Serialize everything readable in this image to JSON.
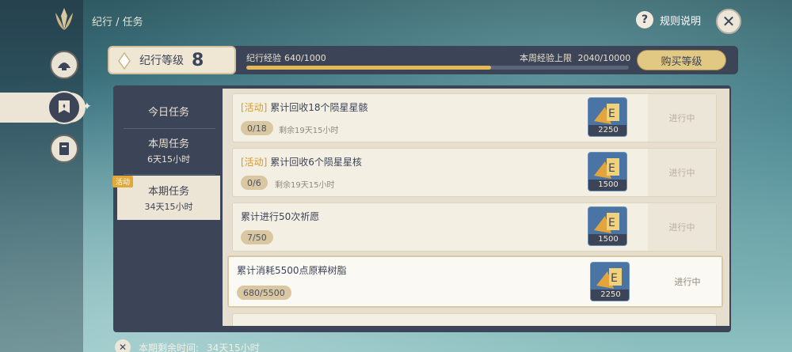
{
  "breadcrumb": "纪行 / 任务",
  "header": {
    "rules_label": "规则说明"
  },
  "level": {
    "label": "纪行等级",
    "value": "8",
    "xp_label": "纪行经验",
    "xp_value": "640/1000",
    "xp_fraction": 0.64,
    "week_cap_label": "本周经验上限",
    "week_cap_value": "2040/10000",
    "buy_label": "购买等级"
  },
  "tabs": [
    {
      "title": "今日任务",
      "sub": ""
    },
    {
      "title": "本周任务",
      "sub": "6天15小时"
    },
    {
      "title": "本期任务",
      "sub": "34天15小时",
      "flag": "活动"
    }
  ],
  "quests": [
    {
      "tag": "[活动]",
      "title": "累计回收18个陨星星骸",
      "progress": "0/18",
      "time": "剩余19天15小时",
      "reward": "2250",
      "status": "进行中"
    },
    {
      "tag": "[活动]",
      "title": "累计回收6个陨星星核",
      "progress": "0/6",
      "time": "剩余19天15小时",
      "reward": "1500",
      "status": "进行中"
    },
    {
      "tag": "",
      "title": "累计进行50次祈愿",
      "progress": "7/50",
      "time": "",
      "reward": "1500",
      "status": "进行中"
    },
    {
      "tag": "",
      "title": "累计消耗5500点原粹树脂",
      "progress": "680/5500",
      "time": "",
      "reward": "2250",
      "status": "进行中"
    }
  ],
  "footer": {
    "label": "本期剩余时间:",
    "value": "34天15小时"
  },
  "colors": {
    "panel": "#3c4558",
    "accent": "#e5b955",
    "cream": "#ece5d5",
    "tag": "#d49a2b"
  }
}
